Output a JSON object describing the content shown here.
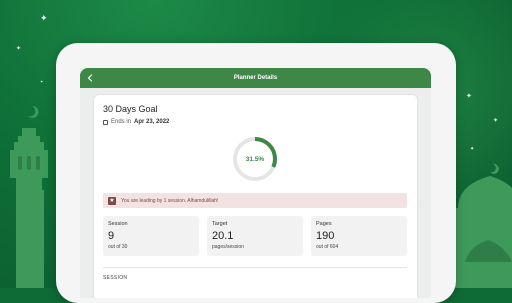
{
  "appbar": {
    "title": "Planner Details"
  },
  "goal": {
    "title": "30 Days Goal",
    "ends_prefix": "Ends in",
    "ends_date": "Apr 23, 2022",
    "progress_label": "31.5%",
    "progress_fraction": 0.315
  },
  "alert": {
    "text": "You are leading by 1 session. Alhamdulillah!"
  },
  "stats": [
    {
      "label": "Session",
      "value": "9",
      "sub": "out of 30"
    },
    {
      "label": "Target",
      "value": "20.1",
      "sub": "pages/session"
    },
    {
      "label": "Pages",
      "value": "190",
      "sub": "out of 604"
    }
  ],
  "section": {
    "title": "SESSION"
  },
  "colors": {
    "primary": "#3f8746",
    "background": "#0f7038",
    "alert_bg": "#f3e2e2",
    "track": "#e3e6e3"
  }
}
